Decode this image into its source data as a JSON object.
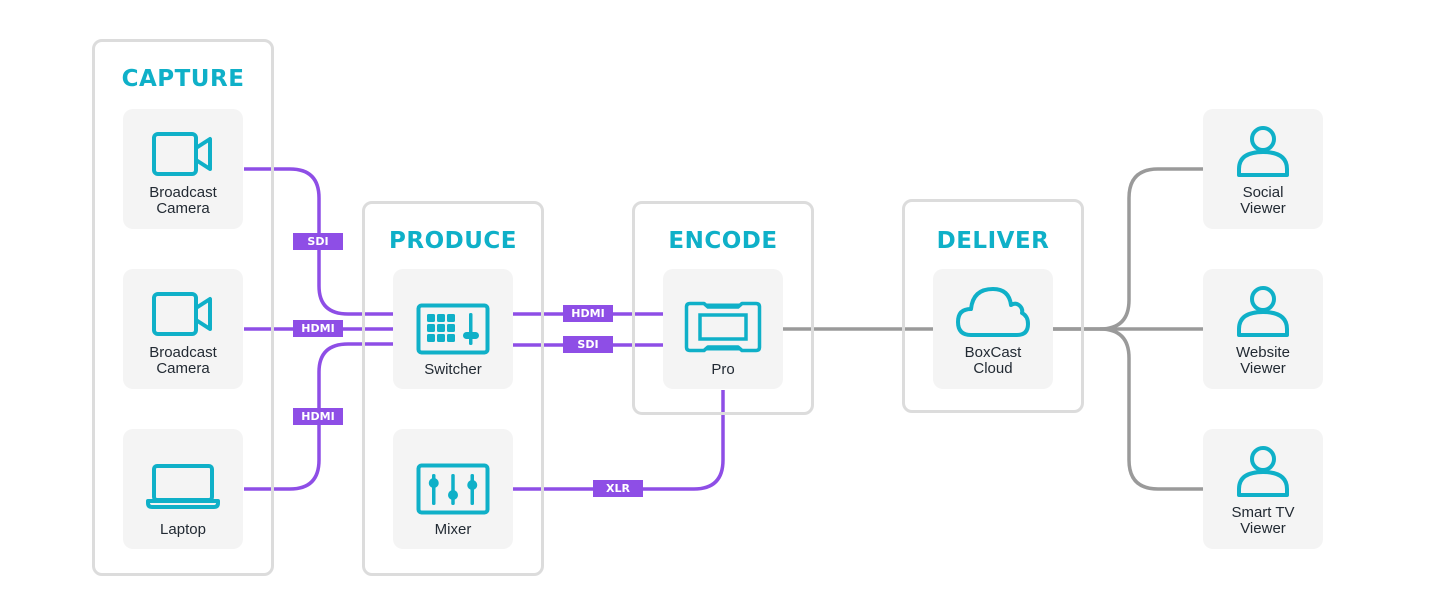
{
  "colors": {
    "accent": "#0fb0c8",
    "wire_signal": "#8e4ee6",
    "wire_network": "#9a9a9a",
    "group_border": "#dcdcdc",
    "node_bg": "#f4f4f4",
    "label_text": "#222a33"
  },
  "groups": {
    "capture": {
      "title": "CAPTURE"
    },
    "produce": {
      "title": "PRODUCE"
    },
    "encode": {
      "title": "ENCODE"
    },
    "deliver": {
      "title": "DELIVER"
    }
  },
  "nodes": {
    "camera1": {
      "icon": "video-camera-icon",
      "label_line1": "Broadcast",
      "label_line2": "Camera"
    },
    "camera2": {
      "icon": "video-camera-icon",
      "label_line1": "Broadcast",
      "label_line2": "Camera"
    },
    "laptop": {
      "icon": "laptop-icon",
      "label_line1": "Laptop"
    },
    "switcher": {
      "icon": "switcher-icon",
      "label_line1": "Switcher"
    },
    "mixer": {
      "icon": "mixer-icon",
      "label_line1": "Mixer"
    },
    "pro": {
      "icon": "encoder-icon",
      "label_line1": "Pro"
    },
    "cloud": {
      "icon": "cloud-icon",
      "label_line1": "BoxCast",
      "label_line2": "Cloud"
    },
    "social": {
      "icon": "user-icon",
      "label_line1": "Social",
      "label_line2": "Viewer"
    },
    "website": {
      "icon": "user-icon",
      "label_line1": "Website",
      "label_line2": "Viewer"
    },
    "smarttv": {
      "icon": "user-icon",
      "label_line1": "Smart TV",
      "label_line2": "Viewer"
    }
  },
  "connections": {
    "camera1_to_switcher": "SDI",
    "camera2_to_switcher": "HDMI",
    "laptop_to_switcher": "HDMI",
    "switcher_to_pro_1": "HDMI",
    "switcher_to_pro_2": "SDI",
    "mixer_to_pro": "XLR"
  }
}
